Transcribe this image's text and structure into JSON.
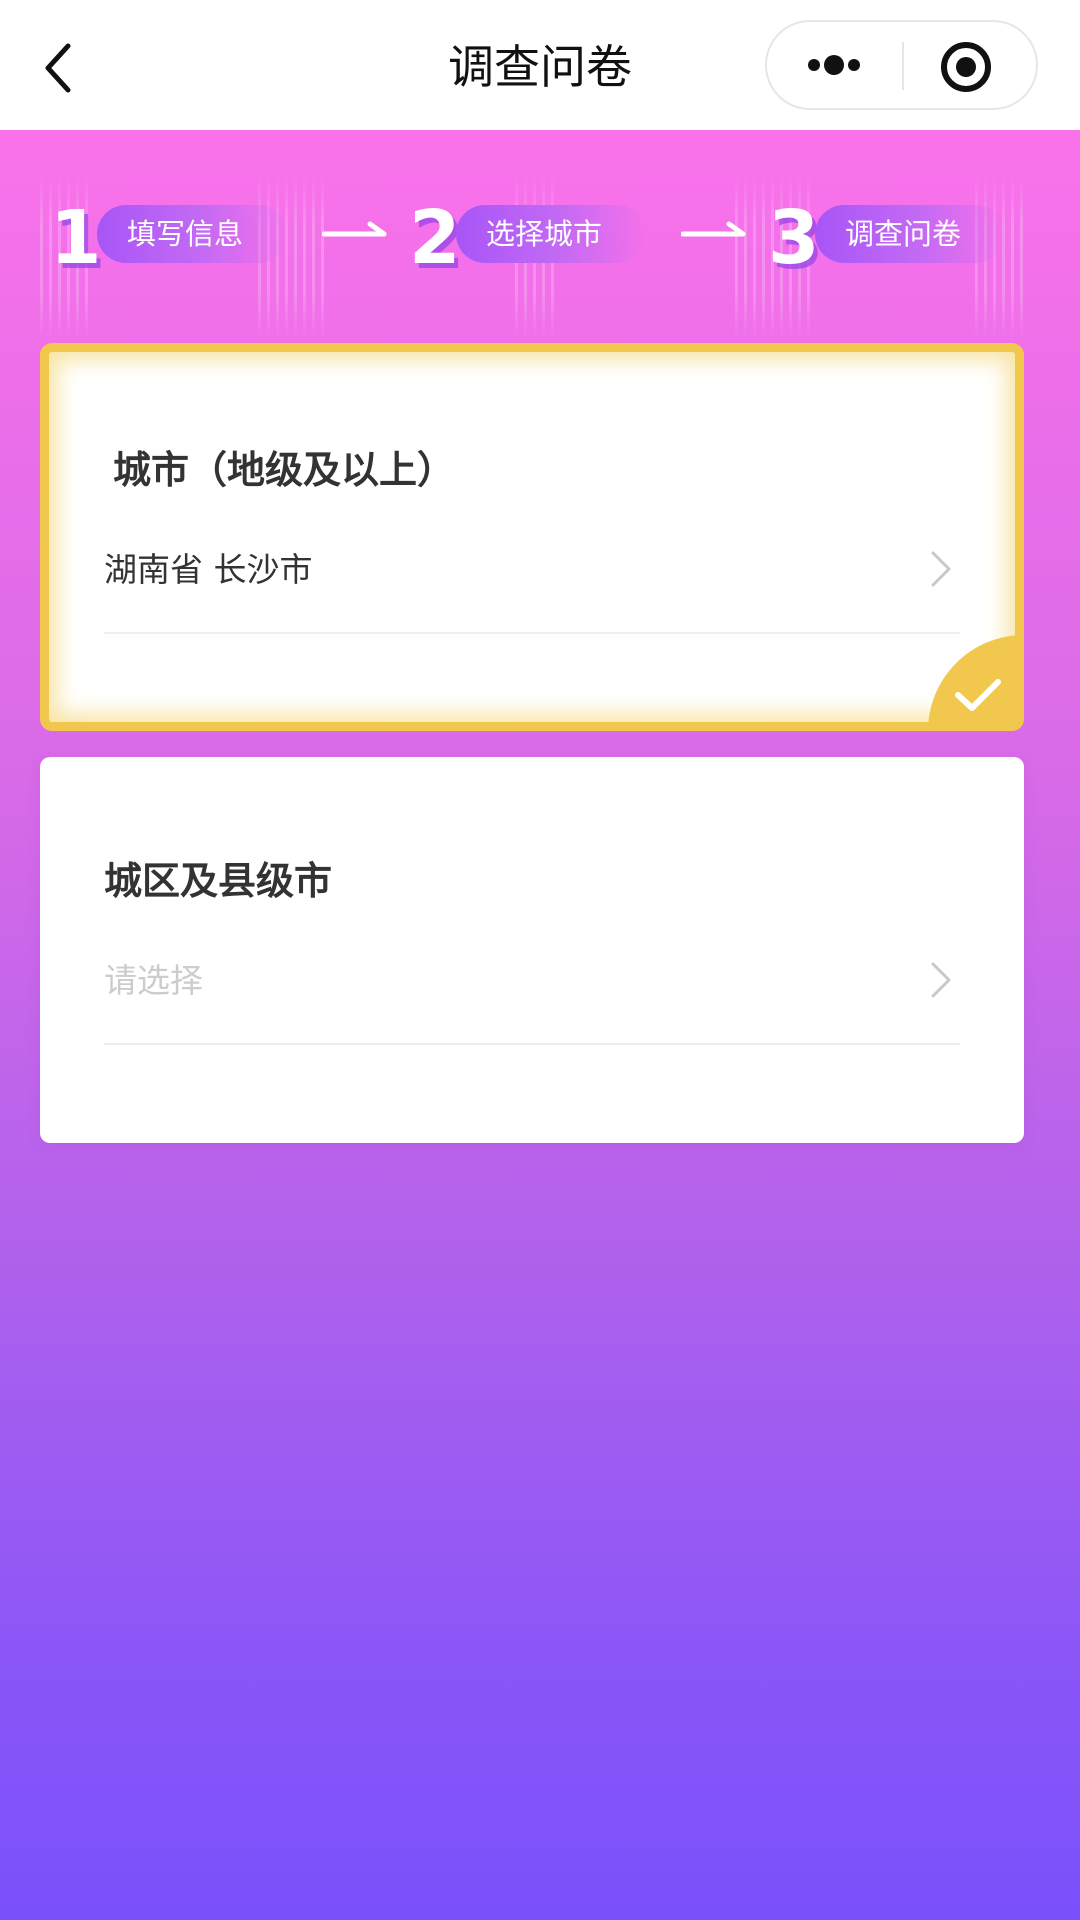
{
  "nav": {
    "title": "调查问卷",
    "back_icon": "chevron-left-icon",
    "more_icon": "more-dots-icon",
    "close_icon": "target-circle-icon"
  },
  "steps": [
    {
      "number": "1",
      "label": "填写信息"
    },
    {
      "number": "2",
      "label": "选择城市"
    },
    {
      "number": "3",
      "label": "调查问卷"
    }
  ],
  "city_card": {
    "title": "城市（地级及以上）",
    "value": "湖南省 长沙市",
    "selected": true
  },
  "district_card": {
    "title": "城区及县级市",
    "placeholder": "请选择",
    "value": ""
  },
  "colors": {
    "accent_yellow": "#f1c84d",
    "background_top": "#ff74ec",
    "background_bottom": "#7a50fb",
    "step_pill": "#a855f7"
  }
}
